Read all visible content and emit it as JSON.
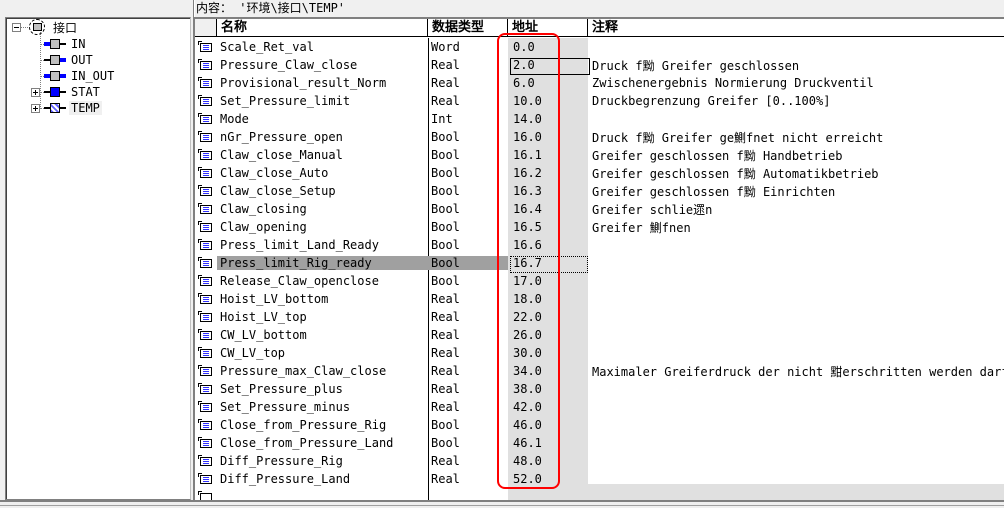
{
  "tree": {
    "root": {
      "label": "接口",
      "expanded": true
    },
    "items": [
      {
        "label": "IN",
        "icon": "interface-in-icon",
        "expandable": false
      },
      {
        "label": "OUT",
        "icon": "interface-out-icon",
        "expandable": false
      },
      {
        "label": "IN_OUT",
        "icon": "interface-inout-icon",
        "expandable": false
      },
      {
        "label": "STAT",
        "icon": "interface-stat-icon",
        "expandable": true
      },
      {
        "label": "TEMP",
        "icon": "interface-temp-icon",
        "expandable": true,
        "selected": true
      }
    ]
  },
  "content": {
    "label": "内容：  '环境\\接口\\TEMP'"
  },
  "table": {
    "headers": {
      "name": "名称",
      "type": "数据类型",
      "address": "地址",
      "comment": "注释"
    },
    "rows": [
      {
        "name": "Scale_Ret_val",
        "type": "Word",
        "address": "0.0",
        "comment": ""
      },
      {
        "name": "Pressure_Claw_close",
        "type": "Real",
        "address": "2.0",
        "comment": "Druck f黝 Greifer geschlossen"
      },
      {
        "name": "Provisional_result_Norm",
        "type": "Real",
        "address": "6.0",
        "comment": "Zwischenergebnis Normierung Druckventil"
      },
      {
        "name": "Set_Pressure_limit",
        "type": "Real",
        "address": "10.0",
        "comment": "Druckbegrenzung Greifer [0..100%]"
      },
      {
        "name": "Mode",
        "type": "Int",
        "address": "14.0",
        "comment": ""
      },
      {
        "name": "nGr_Pressure_open",
        "type": "Bool",
        "address": "16.0",
        "comment": "Druck f黝 Greifer ge鰂fnet nicht erreicht"
      },
      {
        "name": "Claw_close_Manual",
        "type": "Bool",
        "address": "16.1",
        "comment": "Greifer geschlossen f黝 Handbetrieb"
      },
      {
        "name": "Claw_close_Auto",
        "type": "Bool",
        "address": "16.2",
        "comment": "Greifer geschlossen f黝 Automatikbetrieb"
      },
      {
        "name": "Claw_close_Setup",
        "type": "Bool",
        "address": "16.3",
        "comment": "Greifer geschlossen f黝 Einrichten"
      },
      {
        "name": "Claw_closing",
        "type": "Bool",
        "address": "16.4",
        "comment": "Greifer schlie遝n"
      },
      {
        "name": "Claw_opening",
        "type": "Bool",
        "address": "16.5",
        "comment": "Greifer 鰂fnen"
      },
      {
        "name": "Press_limit_Land_Ready",
        "type": "Bool",
        "address": "16.6",
        "comment": ""
      },
      {
        "name": "Press_limit_Rig_ready",
        "type": "Bool",
        "address": "16.7",
        "comment": "",
        "selected": true
      },
      {
        "name": "Release_Claw_openclose",
        "type": "Bool",
        "address": "17.0",
        "comment": ""
      },
      {
        "name": "Hoist_LV_bottom",
        "type": "Real",
        "address": "18.0",
        "comment": ""
      },
      {
        "name": "Hoist_LV_top",
        "type": "Real",
        "address": "22.0",
        "comment": ""
      },
      {
        "name": "CW_LV_bottom",
        "type": "Real",
        "address": "26.0",
        "comment": ""
      },
      {
        "name": "CW_LV_top",
        "type": "Real",
        "address": "30.0",
        "comment": ""
      },
      {
        "name": "Pressure_max_Claw_close",
        "type": "Real",
        "address": "34.0",
        "comment": "Maximaler Greiferdruck der nicht 黚erschritten werden darf"
      },
      {
        "name": "Set_Pressure_plus",
        "type": "Real",
        "address": "38.0",
        "comment": ""
      },
      {
        "name": "Set_Pressure_minus",
        "type": "Real",
        "address": "42.0",
        "comment": ""
      },
      {
        "name": "Close_from_Pressure_Rig",
        "type": "Bool",
        "address": "46.0",
        "comment": ""
      },
      {
        "name": "Close_from_Pressure_Land",
        "type": "Bool",
        "address": "46.1",
        "comment": ""
      },
      {
        "name": "Diff_Pressure_Rig",
        "type": "Real",
        "address": "48.0",
        "comment": ""
      },
      {
        "name": "Diff_Pressure_Land",
        "type": "Real",
        "address": "52.0",
        "comment": ""
      }
    ]
  },
  "colors": {
    "selection": "#a0a0a0",
    "address_column_bg": "#e0e0e0",
    "annotation_red": "#ff0000",
    "icon_blue": "#0000ff"
  }
}
